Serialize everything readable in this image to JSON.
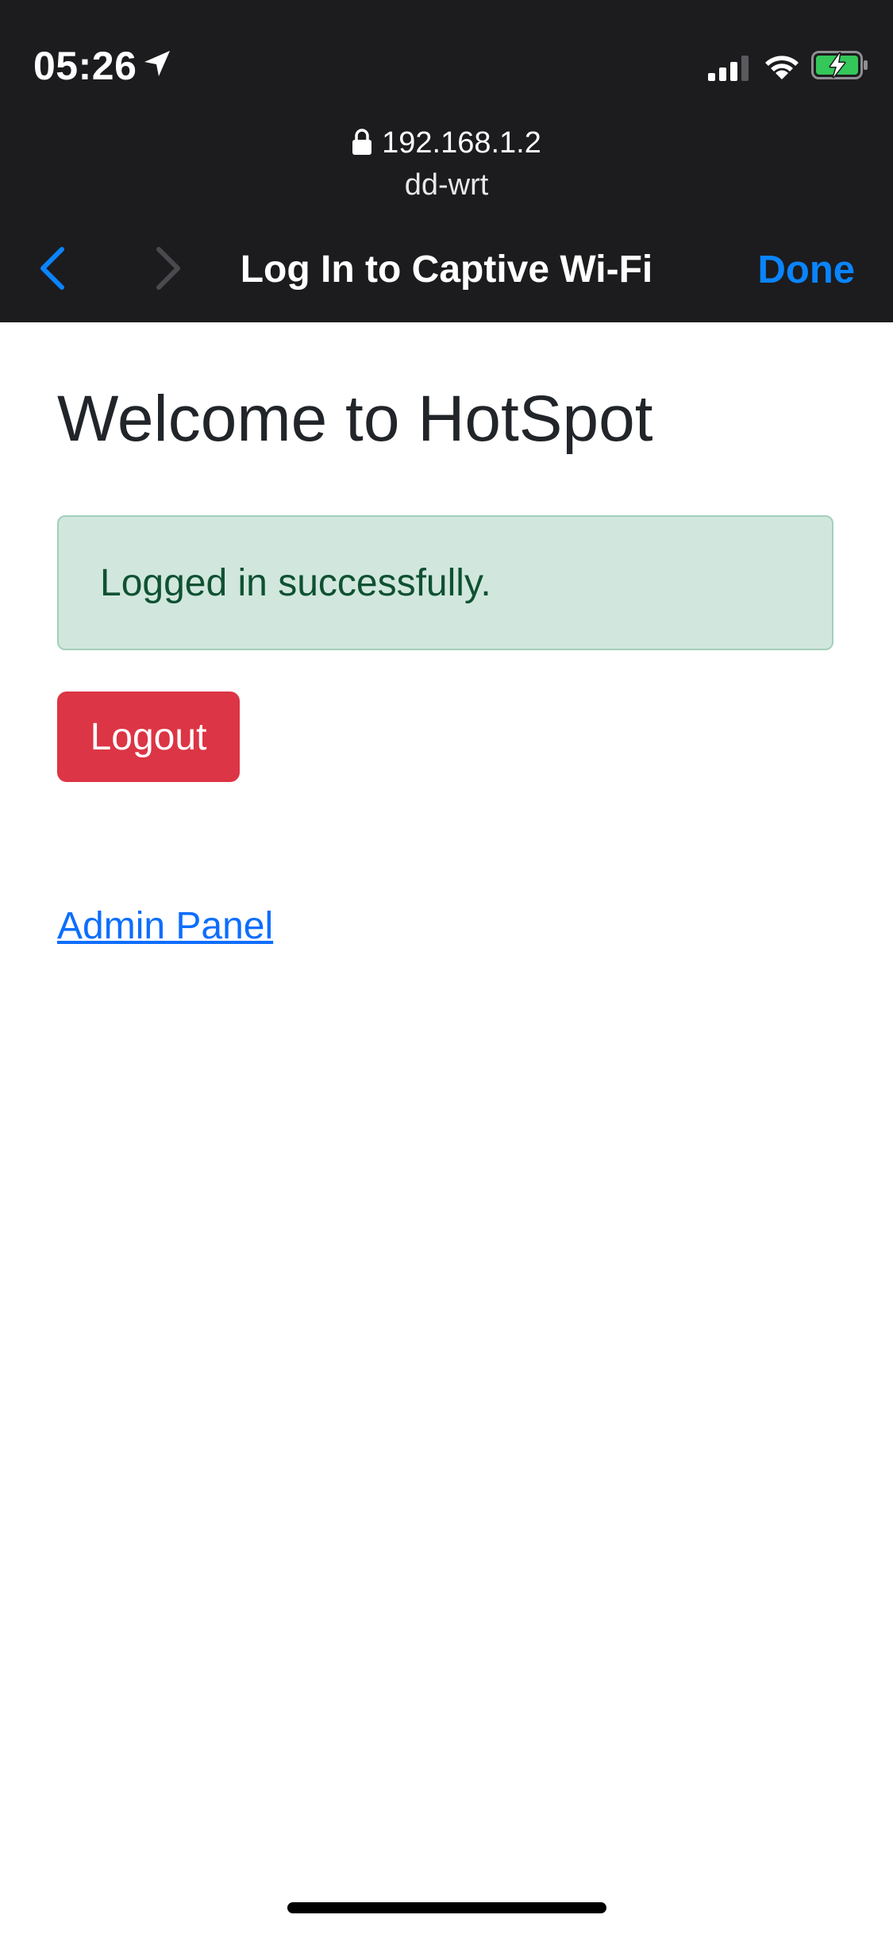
{
  "status_bar": {
    "time": "05:26",
    "icons": [
      "location-arrow-icon",
      "cellular-signal-icon",
      "wifi-icon",
      "battery-charging-icon"
    ],
    "battery_color": "#34c759"
  },
  "browser": {
    "address": "192.168.1.2",
    "host": "dd-wrt",
    "title": "Log In to Captive Wi-Fi",
    "done_label": "Done",
    "chrome_color": "#1c1c1e",
    "accent_color": "#0a84ff"
  },
  "page": {
    "heading": "Welcome to HotSpot",
    "alert": {
      "text": "Logged in successfully.",
      "background": "#d1e7dd",
      "text_color": "#0f5132"
    },
    "logout_label": "Logout",
    "logout_color": "#dc3545",
    "admin_link": "Admin Panel",
    "link_color": "#0d6efd"
  }
}
